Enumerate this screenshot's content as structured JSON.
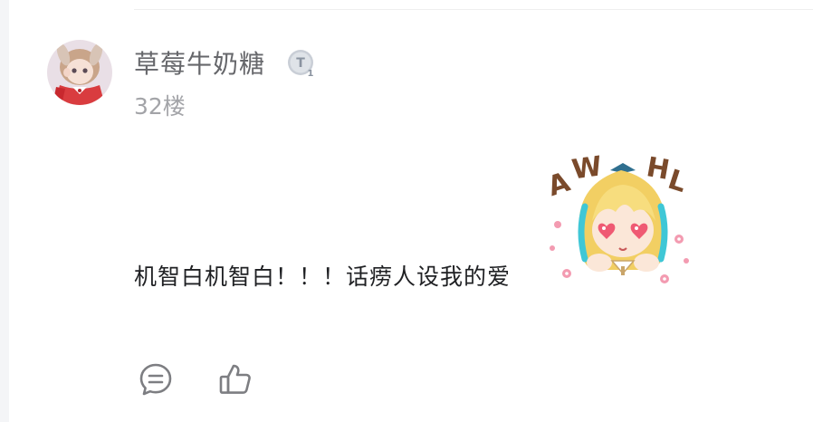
{
  "post": {
    "author": {
      "name": "草莓牛奶糖",
      "level_badge": "T1",
      "avatar_icon": "anime-avatar-icon"
    },
    "floor": "32楼",
    "content": "机智白机智白！！！话痨人设我的爱",
    "sticker": {
      "icon": "anime-sticker-icon",
      "text": "AWHL"
    },
    "actions": {
      "reply_icon": "comment-icon",
      "like_icon": "thumbs-up-icon"
    }
  },
  "colors": {
    "name": "#66676b",
    "floor": "#a3a4a8",
    "content": "#1f2023",
    "icon": "#7d7e82",
    "sticker_text": "#7a4a2b"
  }
}
